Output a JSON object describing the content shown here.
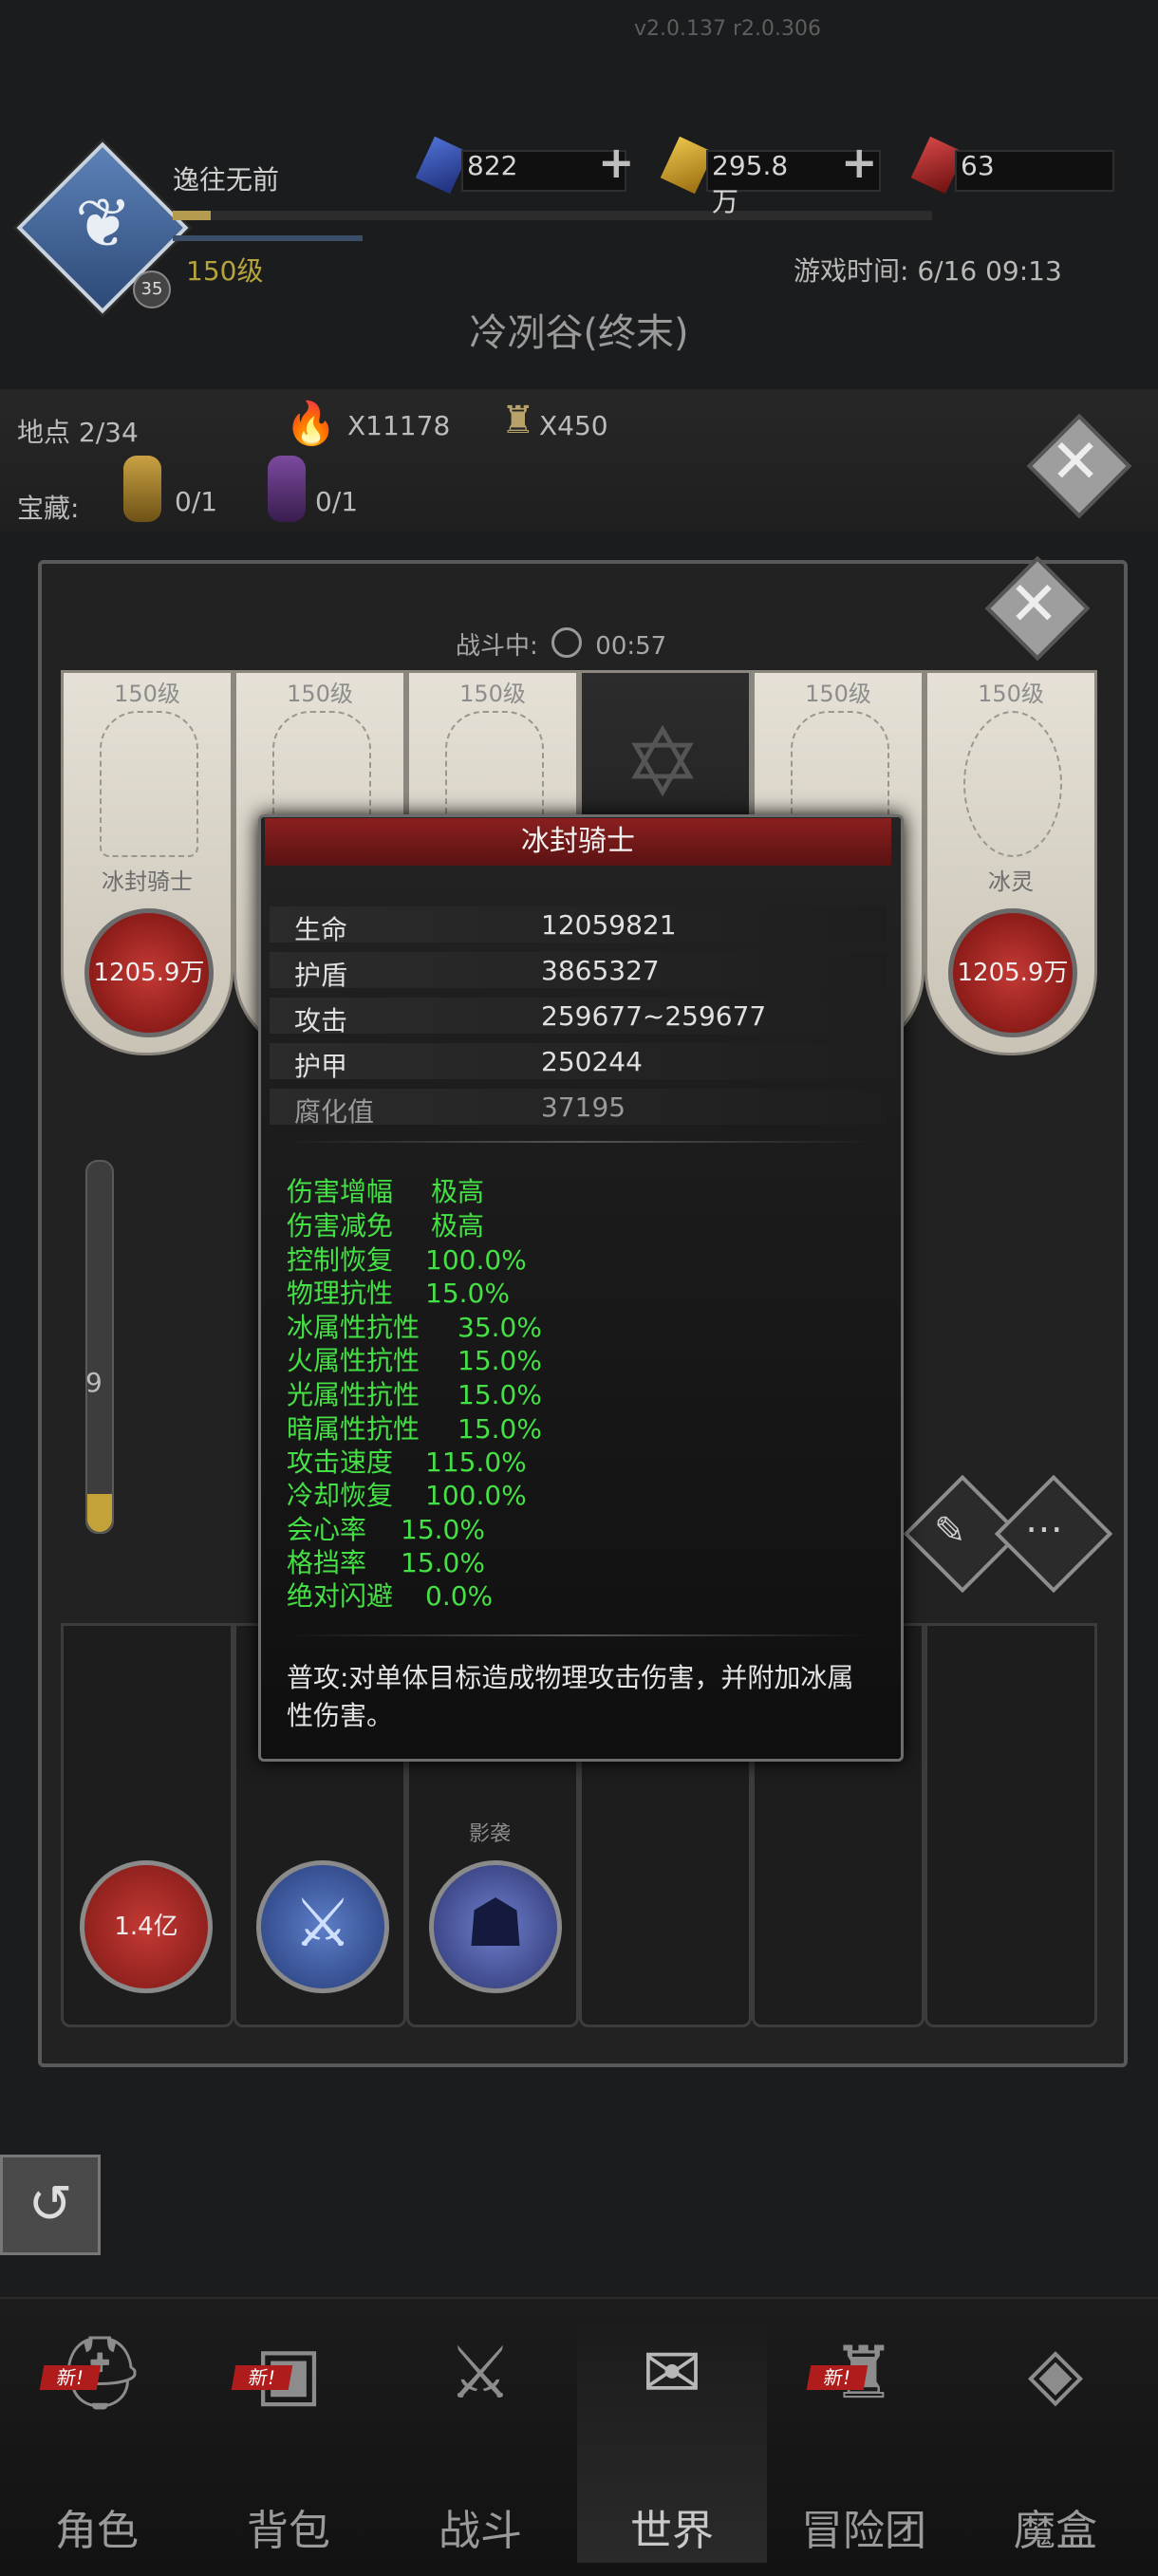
{
  "version": "v2.0.137 r2.0.306",
  "player": {
    "name": "逸往无前",
    "level_label": "150级",
    "badge": "35",
    "exp_fraction": 0.05
  },
  "resources": [
    {
      "icon": "blue-gem-icon",
      "value": "822"
    },
    {
      "icon": "gold-gem-icon",
      "value": "295.8万"
    },
    {
      "icon": "red-gem-icon",
      "value": "63"
    }
  ],
  "game_time": "游戏时间: 6/16 09:13",
  "area_title": "冷冽谷(终末)",
  "location": {
    "label": "地点 2/34",
    "torch_count": "X11178",
    "lantern_count": "X450"
  },
  "treasure": {
    "label": "宝藏:",
    "gold": "0/1",
    "purple": "0/1"
  },
  "battle": {
    "label": "战斗中:",
    "time": "00:57"
  },
  "enemy_cards": [
    {
      "level": "150级",
      "name": "冰封骑士",
      "hp": "1205.9万"
    },
    {
      "level": "150级",
      "name": "",
      "hp": ""
    },
    {
      "level": "150级",
      "name": "",
      "hp": ""
    },
    {
      "level": "",
      "name": "",
      "hp": ""
    },
    {
      "level": "150级",
      "name": "",
      "hp": ""
    },
    {
      "level": "150级",
      "name": "冰灵",
      "hp": "1205.9万"
    }
  ],
  "side_gauge": {
    "value": "9"
  },
  "player_hp": "1.4亿",
  "skill_label": "影袭",
  "popup": {
    "title": "冰封骑士",
    "stats": [
      {
        "label": "生命",
        "value": "12059821"
      },
      {
        "label": "护盾",
        "value": "3865327"
      },
      {
        "label": "攻击",
        "value": "259677~259677"
      },
      {
        "label": "护甲",
        "value": "250244"
      },
      {
        "label": "腐化值",
        "value": "37195"
      }
    ],
    "attributes": [
      {
        "label": "伤害增幅",
        "value": "极高"
      },
      {
        "label": "伤害减免",
        "value": "极高"
      },
      {
        "label": "控制恢复",
        "value": "100.0%"
      },
      {
        "label": "物理抗性",
        "value": "15.0%"
      },
      {
        "label": "冰属性抗性",
        "value": "35.0%"
      },
      {
        "label": "火属性抗性",
        "value": "15.0%"
      },
      {
        "label": "光属性抗性",
        "value": "15.0%"
      },
      {
        "label": "暗属性抗性",
        "value": "15.0%"
      },
      {
        "label": "攻击速度",
        "value": "115.0%"
      },
      {
        "label": "冷却恢复",
        "value": "100.0%"
      },
      {
        "label": "会心率",
        "value": "15.0%"
      },
      {
        "label": "格挡率",
        "value": "15.0%"
      },
      {
        "label": "绝对闪避",
        "value": "0.0%"
      }
    ],
    "description": "普攻:对单体目标造成物理攻击伤害，并附加冰属性伤害。"
  },
  "nav": [
    {
      "label": "角色",
      "icon": "helmet-icon",
      "new": "新!"
    },
    {
      "label": "背包",
      "icon": "backpack-icon",
      "new": "新!"
    },
    {
      "label": "战斗",
      "icon": "shield-sword-icon",
      "new": ""
    },
    {
      "label": "世界",
      "icon": "map-scroll-icon",
      "new": ""
    },
    {
      "label": "冒险团",
      "icon": "castle-icon",
      "new": "新!"
    },
    {
      "label": "魔盒",
      "icon": "magic-cube-icon",
      "new": ""
    }
  ]
}
